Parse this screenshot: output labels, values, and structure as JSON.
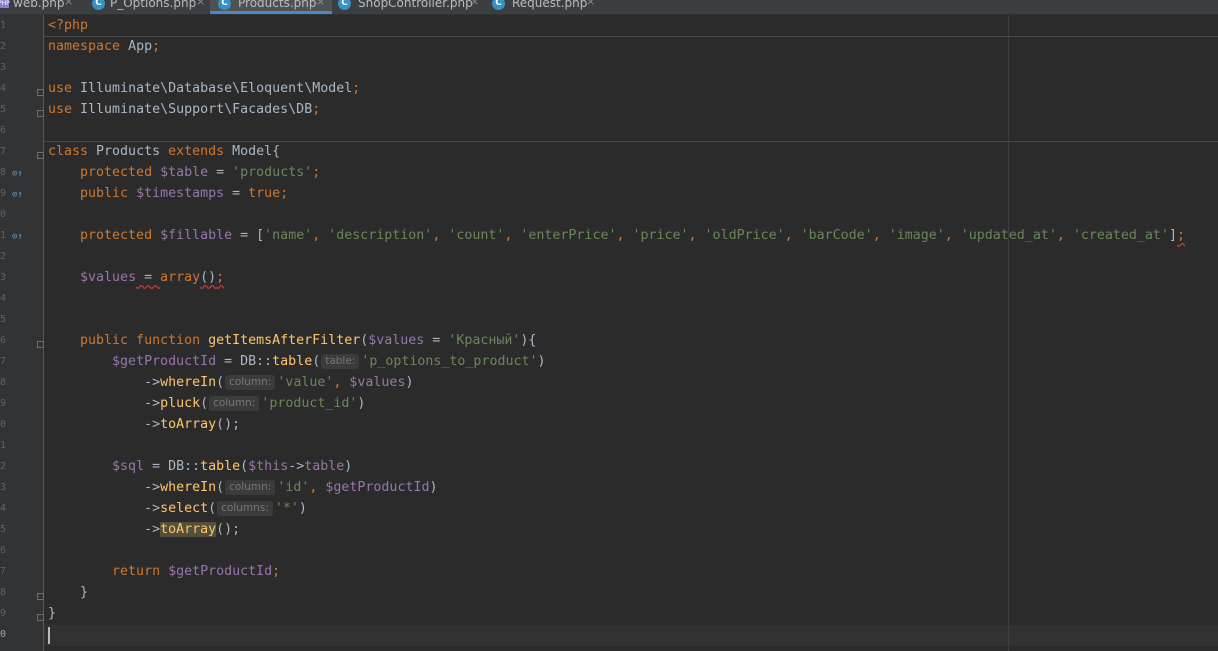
{
  "tabs": [
    {
      "label": "web.php",
      "icon": "php-file-icon"
    },
    {
      "label": "P_Options.php",
      "icon": "class-icon"
    },
    {
      "label": "Products.php",
      "icon": "class-icon",
      "active": true
    },
    {
      "label": "ShopController.php",
      "icon": "class-icon"
    },
    {
      "label": "Request.php",
      "icon": "class-icon"
    }
  ],
  "close_glyph": "×",
  "gutter": {
    "line_numbers": [
      "1",
      "2",
      "3",
      "4",
      "5",
      "6",
      "7",
      "8",
      "9",
      "0",
      "1",
      "2",
      "3",
      "4",
      "5",
      "6",
      "7",
      "8",
      "9",
      "0",
      "1",
      "2",
      "3",
      "4",
      "5",
      "6",
      "7",
      "8",
      "9",
      "0"
    ]
  },
  "code": {
    "l1": {
      "php_open": "<?php"
    },
    "l2": {
      "kw": "namespace",
      "name": " App",
      "semi": ";"
    },
    "l4": {
      "kw": "use",
      "path": " Illuminate\\Database\\Eloquent\\Model",
      "semi": ";"
    },
    "l5": {
      "kw": "use",
      "path": " Illuminate\\Support\\Facades\\DB",
      "semi": ";"
    },
    "l7": {
      "kw1": "class",
      "name": " Products ",
      "kw2": "extends",
      "parent": " Model{"
    },
    "l8": {
      "kw": "    protected ",
      "var": "$table",
      "eq": " = ",
      "str": "'products'",
      "semi": ";"
    },
    "l9": {
      "kw": "    public ",
      "var": "$timestamps",
      "eq": " = ",
      "val": "true",
      "semi": ";"
    },
    "l11": {
      "kw": "    protected ",
      "var": "$fillable",
      "eq": " = [",
      "items": [
        "'name'",
        "'description'",
        "'count'",
        "'enterPrice'",
        "'price'",
        "'oldPrice'",
        "'barCode'",
        "'image'",
        "'updated_at'",
        "'created_at'"
      ],
      "sep": ", ",
      "close": "]",
      "semi": ";"
    },
    "l13": {
      "indent": "    ",
      "var": "$values",
      "eq": " = ",
      "fn": "array",
      "paren": "()",
      "semi": ";"
    },
    "l16": {
      "kw": "    public function ",
      "fn": "getItemsAfterFilter",
      "open": "(",
      "var": "$values",
      "eq": " = ",
      "str": "'Красный'",
      "close": "){"
    },
    "l17": {
      "indent": "        ",
      "var": "$getProductId",
      "eq": " = DB::",
      "fn": "table",
      "open": "(",
      "hint": "table:",
      "str": "'p_options_to_product'",
      "close": ")"
    },
    "l18": {
      "indent": "            ->",
      "fn": "whereIn",
      "open": "(",
      "hint": "column:",
      "str": "'value'",
      "sep": ", ",
      "var": "$values",
      "close": ")"
    },
    "l19": {
      "indent": "            ->",
      "fn": "pluck",
      "open": "(",
      "hint": "column:",
      "str": "'product_id'",
      "close": ")"
    },
    "l20": {
      "indent": "            ->",
      "fn": "toArray",
      "close": "();"
    },
    "l22": {
      "indent": "        ",
      "var": "$sql",
      "eq": " = DB::",
      "fn": "table",
      "open": "(",
      "var2": "$this",
      "arrow": "->",
      "prop": "table",
      "close": ")"
    },
    "l23": {
      "indent": "            ->",
      "fn": "whereIn",
      "open": "(",
      "hint": "column:",
      "str": "'id'",
      "sep": ", ",
      "var": "$getProductId",
      "close": ")"
    },
    "l24": {
      "indent": "            ->",
      "fn": "select",
      "open": "(",
      "hint": "columns:",
      "str": "'*'",
      "close": ")"
    },
    "l25": {
      "indent": "            ->",
      "fn": "toArray",
      "close": "();"
    },
    "l27": {
      "kw": "        return ",
      "var": "$getProductId",
      "semi": ";"
    },
    "l28": {
      "text": "    }"
    },
    "l29": {
      "text": "}"
    }
  }
}
